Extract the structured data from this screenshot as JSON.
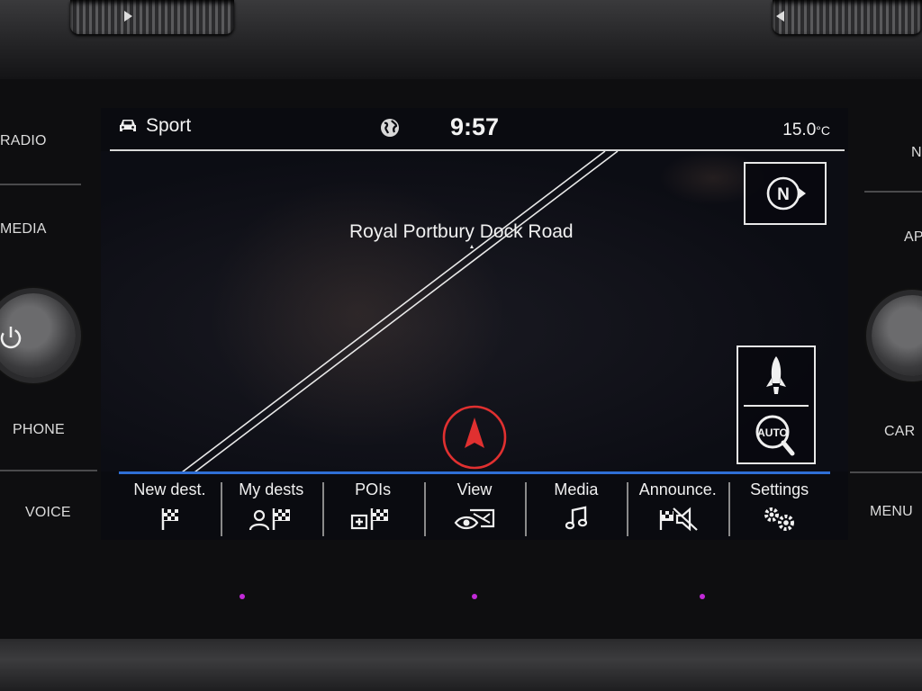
{
  "hardware": {
    "left_buttons": [
      "RADIO",
      "MEDIA",
      "PHONE",
      "VOICE"
    ],
    "right_buttons": [
      "N",
      "AP",
      "CAR",
      "MENU"
    ]
  },
  "status_bar": {
    "mode": "Sport",
    "mode_icon": "car-icon",
    "globe_icon": "globe-icon",
    "time": "9:57",
    "temperature": "15.0",
    "temperature_unit": "°C"
  },
  "map": {
    "road_label": "Royal Portbury Dock Road",
    "compass_label": "N",
    "auto_zoom_label": "AUTO",
    "position_marker": "vehicle-arrow-icon"
  },
  "menu": [
    {
      "label": "New dest.",
      "icon": "flag-icon"
    },
    {
      "label": "My dests",
      "icon": "person-flag-icon"
    },
    {
      "label": "POIs",
      "icon": "poi-flag-icon"
    },
    {
      "label": "View",
      "icon": "map-view-icon"
    },
    {
      "label": "Media",
      "icon": "music-note-icon"
    },
    {
      "label": "Announce.",
      "icon": "speaker-muted-flag-icon"
    },
    {
      "label": "Settings",
      "icon": "gears-icon"
    }
  ],
  "colors": {
    "accent_line": "#2f6fd6",
    "position_marker": "#e03030",
    "led": "#c22ad8"
  }
}
